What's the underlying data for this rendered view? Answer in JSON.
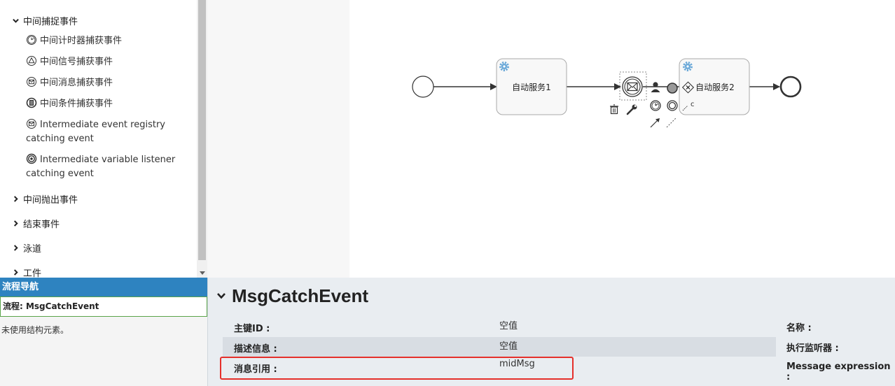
{
  "palette": {
    "intermediate_catch": {
      "label": "中间捕捉事件",
      "items": [
        {
          "label": "中间计时器捕获事件",
          "icon": "timer-icon"
        },
        {
          "label": "中间信号捕获事件",
          "icon": "signal-icon"
        },
        {
          "label": "中间消息捕获事件",
          "icon": "message-icon"
        },
        {
          "label": "中间条件捕获事件",
          "icon": "condition-icon"
        },
        {
          "label": "Intermediate event registry catching event",
          "icon": "message-icon"
        },
        {
          "label": "Intermediate variable listener catching event",
          "icon": "variable-listener-icon"
        }
      ]
    },
    "collapsed_groups": [
      {
        "label": "中间抛出事件"
      },
      {
        "label": "结束事件"
      },
      {
        "label": "泳道"
      },
      {
        "label": "工件"
      }
    ]
  },
  "nav": {
    "title": "流程导航",
    "flow_label": "流程: MsgCatchEvent",
    "empty_text": "未使用结构元素。"
  },
  "diagram": {
    "task1_label": "自动服务1",
    "task2_label": "自动服务2",
    "extra_fragment": "c",
    "accent_color": "#6aa8d8"
  },
  "props": {
    "title": "MsgCatchEvent",
    "rows": [
      {
        "label": "主键ID :",
        "value": "空值"
      },
      {
        "label": "描述信息 :",
        "value": "空值"
      },
      {
        "label": "消息引用 :",
        "value": "midMsg"
      }
    ],
    "right_labels": [
      "名称 :",
      "执行监听器 :",
      "Message expression :"
    ],
    "highlight_color": "#e5302b"
  }
}
